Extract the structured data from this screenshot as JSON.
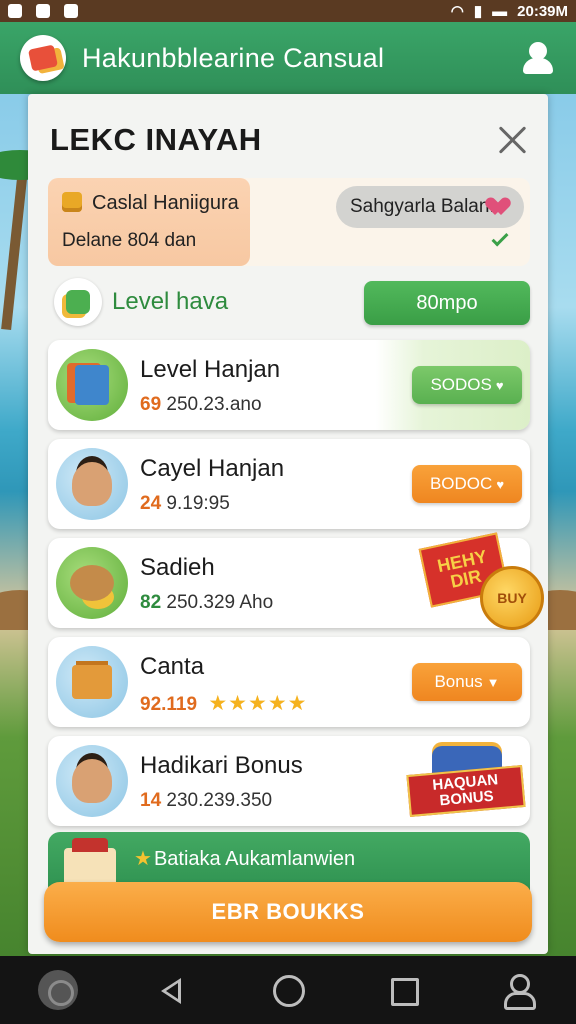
{
  "status_bar": {
    "time": "20:39M"
  },
  "app_bar": {
    "title": "Hakunbblearine Cansual"
  },
  "dialog": {
    "title": "LEKC INAYAH",
    "info_card": {
      "name": "Caslal Haniigura",
      "subtitle": "Delane 804 dan",
      "balance_label": "Sahgyarla Balan."
    },
    "level": {
      "label": "Level hava",
      "button_label": "80mpo"
    },
    "items": [
      {
        "name": "Level Hanjan",
        "lead": "69",
        "value": "250.23.ano",
        "button_label": "SODOS",
        "button_color": "green"
      },
      {
        "name": "Cayel Hanjan",
        "lead": "24",
        "value": "9.19:95",
        "button_label": "BODOC",
        "button_color": "orange"
      },
      {
        "name": "Sadieh",
        "lead": "82",
        "value": "250.329 Aho",
        "promo_text": "HEHY DIR",
        "promo_coin": "BUY"
      },
      {
        "name": "Canta",
        "lead": "92.119",
        "value": "",
        "stars": "★★★★★",
        "button_label": "Bonus",
        "button_color": "orange"
      },
      {
        "name": "Hadikari Bonus",
        "lead": "14",
        "value": "230.239.350",
        "banner_line1": "HAQUAN",
        "banner_line2": "BONUS"
      }
    ],
    "footer_strip": {
      "text": "Batiaka Aukamlanwien"
    },
    "cta_label": "EBR BOUKKS"
  },
  "colors": {
    "primary_green": "#3aa568",
    "accent_orange": "#f08c1d"
  }
}
